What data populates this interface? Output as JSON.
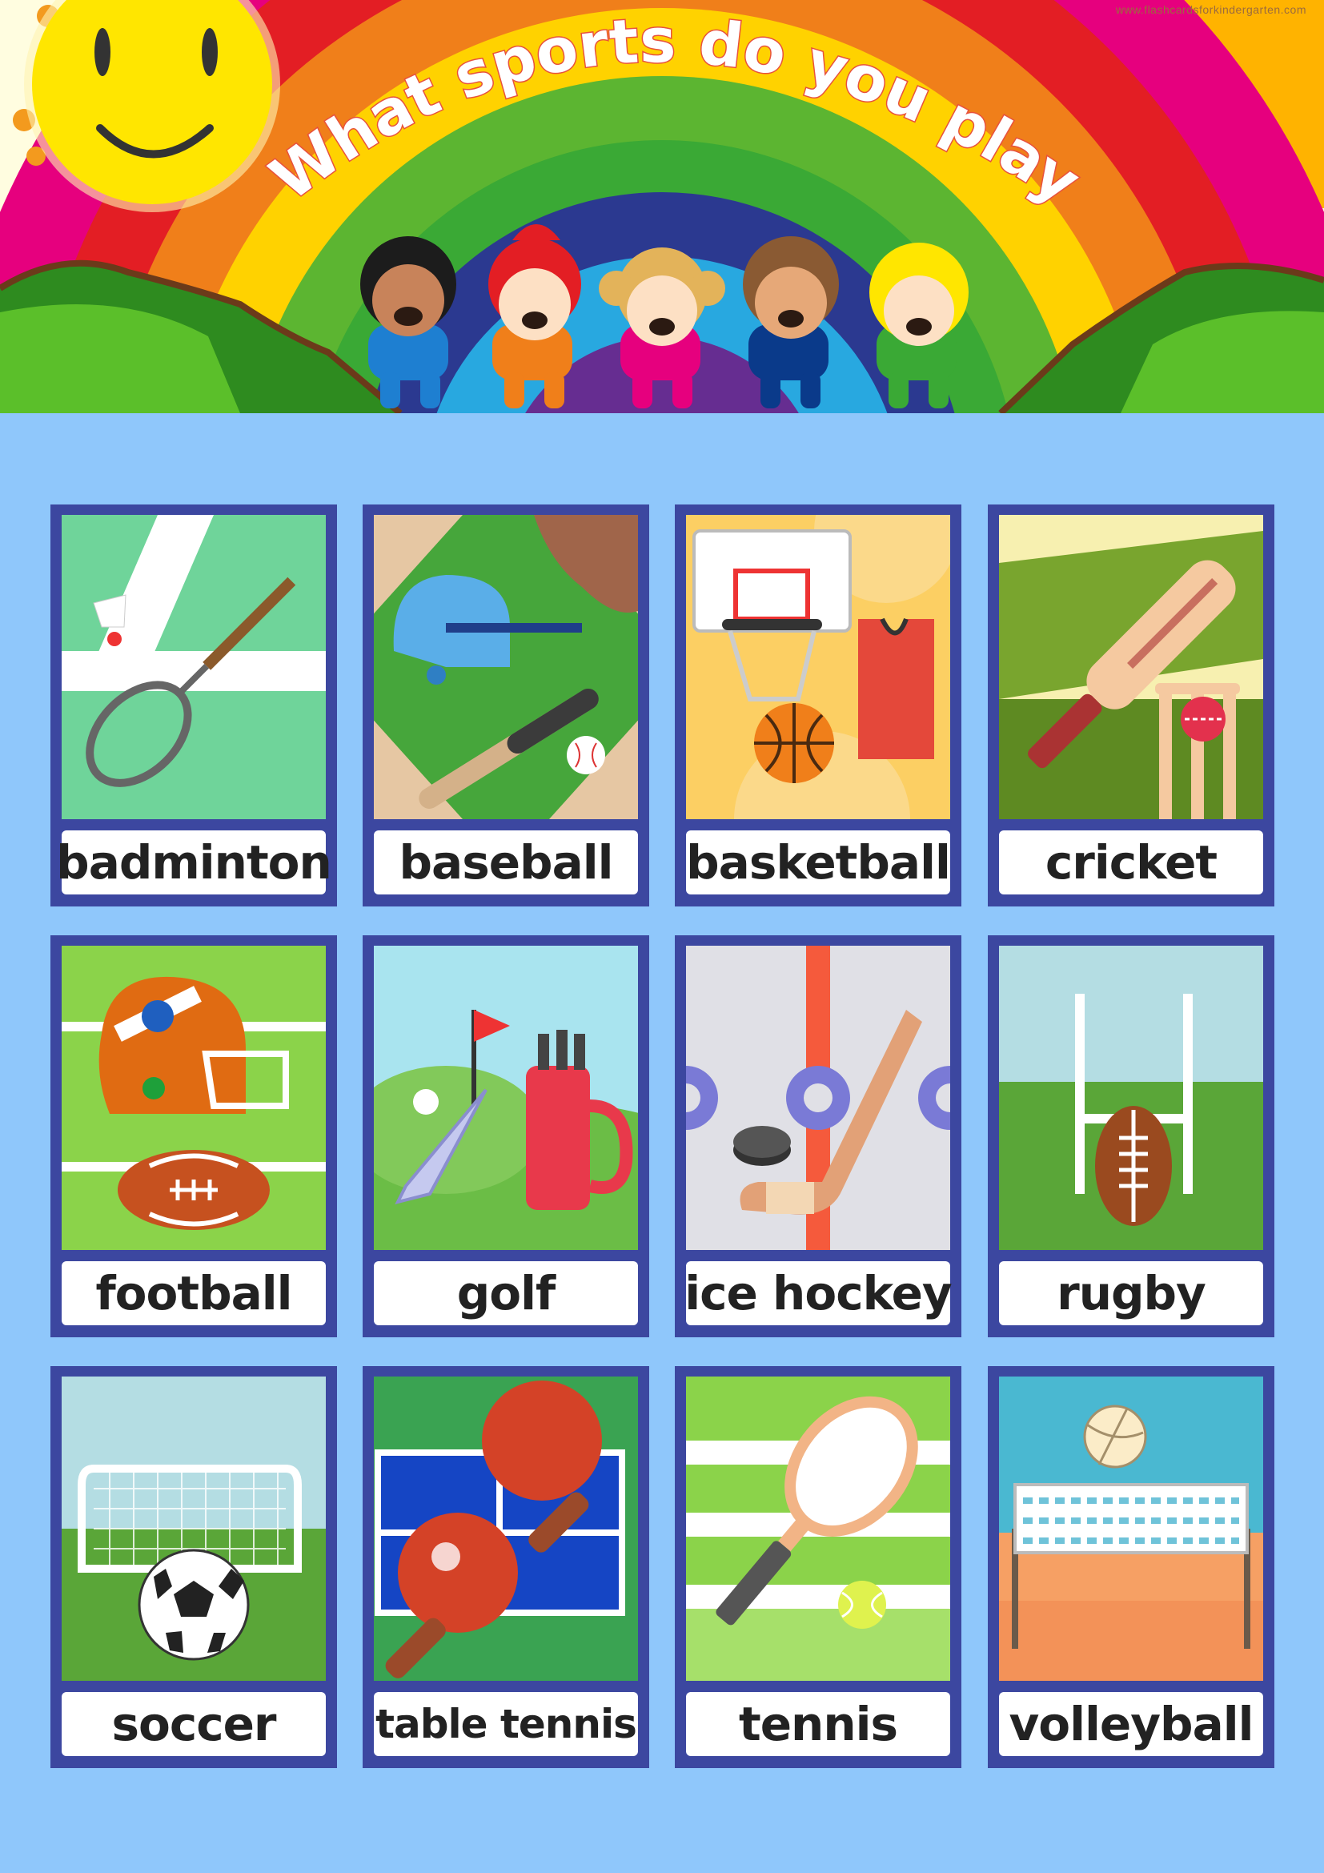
{
  "header": {
    "title": "What sports do you play?",
    "watermark": "www.flashcardsforkindergarten.com"
  },
  "cards": [
    {
      "label": "badminton",
      "icon": "badminton-icon"
    },
    {
      "label": "baseball",
      "icon": "baseball-icon"
    },
    {
      "label": "basketball",
      "icon": "basketball-icon"
    },
    {
      "label": "cricket",
      "icon": "cricket-icon"
    },
    {
      "label": "football",
      "icon": "football-icon"
    },
    {
      "label": "golf",
      "icon": "golf-icon"
    },
    {
      "label": "ice hockey",
      "icon": "ice-hockey-icon"
    },
    {
      "label": "rugby",
      "icon": "rugby-icon"
    },
    {
      "label": "soccer",
      "icon": "soccer-icon"
    },
    {
      "label": "table tennis",
      "icon": "table-tennis-icon"
    },
    {
      "label": "tennis",
      "icon": "tennis-icon"
    },
    {
      "label": "volleyball",
      "icon": "volleyball-icon"
    }
  ],
  "colors": {
    "background": "#8fc7fb",
    "card_frame": "#3c47a0",
    "label_bg": "#ffffff",
    "label_text": "#222222"
  }
}
